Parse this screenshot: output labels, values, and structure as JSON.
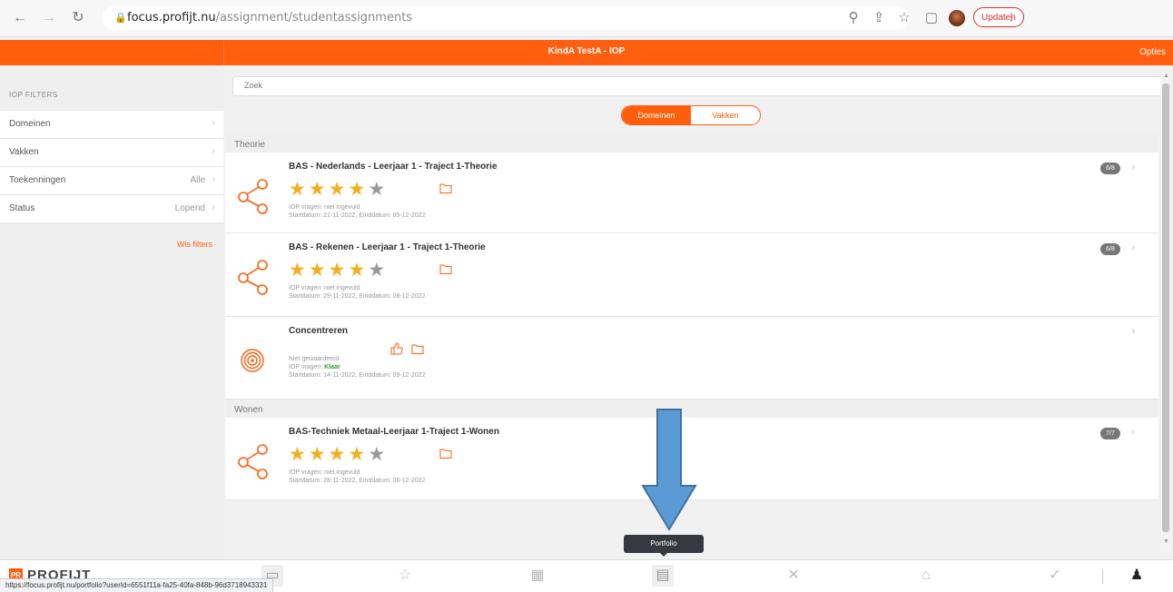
{
  "browser": {
    "url_domain": "focus.profijt.nu",
    "url_path": "/assignment/studentassignments",
    "update_label": "Updaten",
    "status_url": "https://focus.profijt.nu/portfolio?userId=6551f11a-fa25-40fa-848b-96d3718943331"
  },
  "header": {
    "title": "KindA TestA - IOP",
    "options_label": "Opties"
  },
  "sidebar": {
    "heading": "IOP FILTERS",
    "items": [
      {
        "label": "Domeinen",
        "value": ""
      },
      {
        "label": "Vakken",
        "value": ""
      },
      {
        "label": "Toekenningen",
        "value": "Alle"
      },
      {
        "label": "Status",
        "value": "Lopend"
      }
    ],
    "clear_label": "Wis filters"
  },
  "main": {
    "search_placeholder": "Zoek",
    "segments": [
      "Domeinen",
      "Vakken"
    ],
    "sections": [
      {
        "label": "Theorie",
        "cards": [
          {
            "title": "BAS - Nederlands - Leerjaar 1 - Traject 1-Theorie",
            "stars": 4,
            "line1": "IOP vragen: niet ingevuld",
            "line2": "Startdatum: 21-11-2022, Einddatum: 05-12-2022",
            "badge": "6/8",
            "icon": "share-icon"
          },
          {
            "title": "BAS - Rekenen - Leerjaar 1 - Traject 1-Theorie",
            "stars": 4,
            "line1": "IOP vragen: niet ingevuld",
            "line2": "Startdatum: 29-11-2022, Einddatum: 08-12-2022",
            "badge": "6/8",
            "icon": "share-icon"
          },
          {
            "title": "Concentreren",
            "stars": 0,
            "line0": "Niet gewaardeerd",
            "line1_prefix": "IOP vragen: ",
            "line1_value": "Klaar",
            "line2": "Startdatum: 14-11-2022, Einddatum: 09-12-2022",
            "badge": "",
            "icon": "target-icon"
          }
        ]
      },
      {
        "label": "Wonen",
        "cards": [
          {
            "title": "BAS-Techniek Metaal-Leerjaar 1-Traject 1-Wonen",
            "stars": 4,
            "line1": "IOP vragen: niet ingevuld",
            "line2": "Startdatum: 28-11-2022, Einddatum: 06-12-2022",
            "badge": "7/7",
            "icon": "share-icon"
          }
        ]
      }
    ]
  },
  "tooltip": "Portfolio",
  "bottom_nav": {
    "logo": "PROFIJT"
  },
  "colors": {
    "brand": "#ff5e0d",
    "star": "#f2b01e",
    "arrow": "#5b9bd5"
  }
}
